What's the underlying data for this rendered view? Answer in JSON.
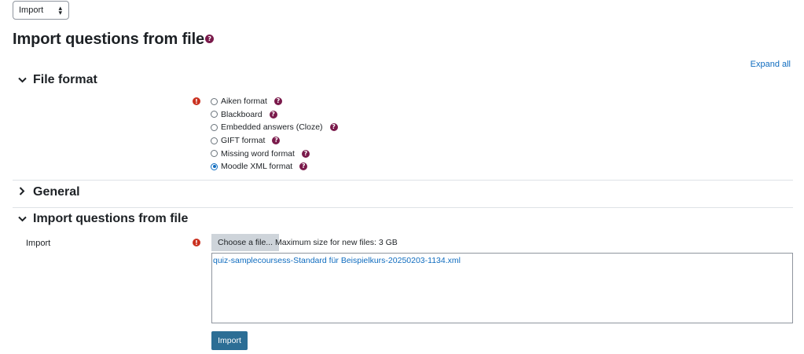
{
  "top_select": {
    "value": "Import"
  },
  "page_title": "Import questions from file",
  "help_glyph": "?",
  "required_glyph": "!",
  "expand_all": "Expand all",
  "sections": {
    "file_format": {
      "title": "File format",
      "expanded": true
    },
    "general": {
      "title": "General",
      "expanded": false
    },
    "import_file": {
      "title": "Import questions from file",
      "expanded": true
    }
  },
  "formats": [
    {
      "label": "Aiken format",
      "checked": false
    },
    {
      "label": "Blackboard",
      "checked": false
    },
    {
      "label": "Embedded answers (Cloze)",
      "checked": false
    },
    {
      "label": "GIFT format",
      "checked": false
    },
    {
      "label": "Missing word format",
      "checked": false
    },
    {
      "label": "Moodle XML format",
      "checked": true
    }
  ],
  "import_field": {
    "label": "Import",
    "choose_button": "Choose a file...",
    "max_size": "Maximum size for new files: 3 GB",
    "selected_file": "quiz-samplecoursess-Standard für Beispielkurs-20250203-1134.xml"
  },
  "submit_button": "Import",
  "colors": {
    "accent": "#0f6cbf",
    "required": "#ca3120",
    "help": "#7a1a4b",
    "primary_button": "#2c6e95"
  },
  "icons": {
    "chevron_expanded": "chevron-down-icon",
    "chevron_collapsed": "chevron-right-icon",
    "help": "question-circle-icon",
    "required": "exclamation-circle-icon"
  }
}
